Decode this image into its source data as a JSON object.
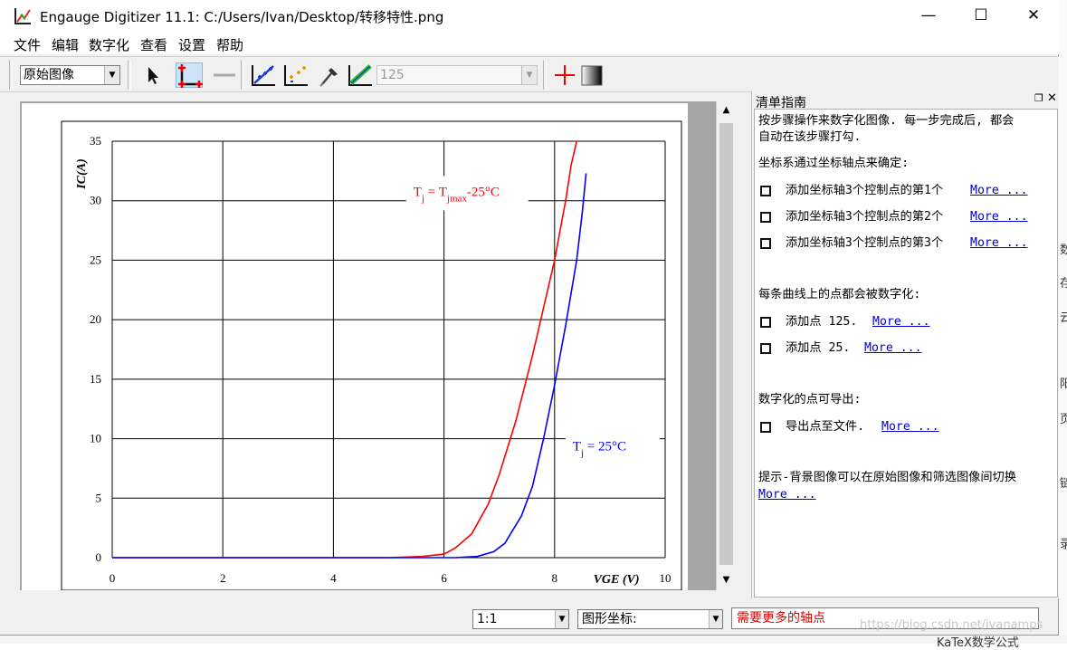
{
  "window": {
    "title": "Engauge Digitizer 11.1: C:/Users/Ivan/Desktop/转移特性.png",
    "minimize": "—",
    "maximize": "☐",
    "close": "✕"
  },
  "menu": [
    "文件",
    "编辑",
    "数字化",
    "查看",
    "设置",
    "帮助"
  ],
  "toolbar": {
    "background_combo": "原始图像",
    "curve_combo": "125"
  },
  "chart_data": {
    "type": "line",
    "ylabel": "IC(A)",
    "xlabel": "VGE (V)",
    "xlim": [
      0,
      10
    ],
    "ylim": [
      0,
      35
    ],
    "x_ticks": [
      "0",
      "2",
      "4",
      "6",
      "8",
      "10"
    ],
    "y_ticks": [
      "0",
      "5",
      "10",
      "15",
      "20",
      "25",
      "30",
      "35"
    ],
    "grid": true,
    "series": [
      {
        "name": "Tj = Tjmax-25°C",
        "color": "#ff0000",
        "x": [
          0,
          5.0,
          5.6,
          6.0,
          6.2,
          6.5,
          6.8,
          7.0,
          7.3,
          7.6,
          7.8,
          8.0,
          8.2,
          8.3,
          8.4
        ],
        "y": [
          0,
          0,
          0.1,
          0.3,
          0.8,
          2.0,
          4.5,
          7.0,
          11.5,
          17.0,
          21.0,
          25.0,
          30.0,
          33.0,
          35.0
        ]
      },
      {
        "name": "Tj = 25°C",
        "color": "#0000ff",
        "x": [
          0,
          6.2,
          6.6,
          6.9,
          7.1,
          7.4,
          7.6,
          7.8,
          8.0,
          8.2,
          8.4,
          8.5,
          8.57
        ],
        "y": [
          0,
          0,
          0.1,
          0.5,
          1.2,
          3.5,
          6.0,
          10.0,
          14.5,
          19.5,
          25.0,
          29.0,
          32.3
        ]
      }
    ],
    "annotations": [
      {
        "base": "T",
        "sub1": "j",
        "mid": " = T",
        "sub2": "jmax",
        "tail": "-25°C",
        "color": "#ff0000"
      },
      {
        "base": "T",
        "sub1": "j",
        "mid": " = 25°C",
        "sub2": "",
        "tail": "",
        "color": "#0000ff"
      }
    ]
  },
  "checklist": {
    "title": "清单指南",
    "intro_1": "按步骤操作来数字化图像. 每一步完成后, 都会",
    "intro_2": "自动在该步骤打勾.",
    "axes_header": "坐标系通过坐标轴点来确定:",
    "axis_items": [
      "添加坐标轴3个控制点的第1个",
      "添加坐标轴3个控制点的第2个",
      "添加坐标轴3个控制点的第3个"
    ],
    "curves_header": "每条曲线上的点都会被数字化:",
    "curve_items": [
      "添加点 125.",
      "添加点 25."
    ],
    "export_header": "数字化的点可导出:",
    "export_item": "导出点至文件.",
    "tip_1": "提示-背景图像可以在原始图像和筛选图像间切换",
    "more": "More ..."
  },
  "status": {
    "zoom": "1:1",
    "coords_mode": "图形坐标:",
    "message": "需要更多的轴点",
    "watermark": "https://blog.csdn.net/ivanamps"
  },
  "background_window": {
    "right_chars": [
      "数",
      "存",
      "云",
      "阳",
      "页",
      "链",
      "录"
    ],
    "bottom_text": "KaTeX数学公式"
  }
}
